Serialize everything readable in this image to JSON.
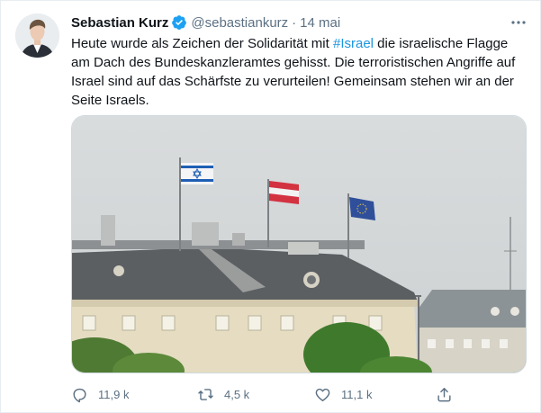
{
  "tweet": {
    "author_name": "Sebastian Kurz",
    "handle": "@sebastiankurz",
    "separator": "·",
    "date": "14 mai",
    "text_before": "Heute wurde als Zeichen der Solidarität mit ",
    "hashtag": "#Israel",
    "text_after": " die israelische Flagge am Dach des Bundeskanzleramtes gehisst. Die terroristischen Angriffe auf Israel sind auf das Schärfste zu verurteilen! Gemeinsam stehen wir an der Seite Israels."
  },
  "actions": {
    "reply_count": "11,9 k",
    "retweet_count": "4,5 k",
    "like_count": "11,1 k"
  },
  "icons": {
    "verified": "verified-badge-icon",
    "more": "more-horizontal-icon",
    "reply": "reply-icon",
    "retweet": "retweet-icon",
    "like": "heart-icon",
    "share": "share-icon"
  },
  "colors": {
    "link": "#1b95e0",
    "verified": "#1da1f2",
    "secondary_text": "#5b7083"
  }
}
